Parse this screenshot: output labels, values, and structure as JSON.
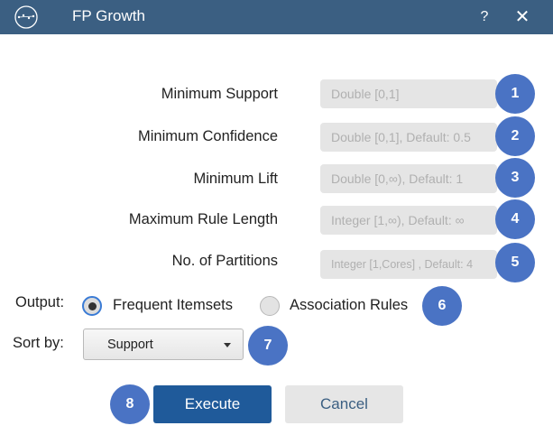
{
  "window": {
    "title": "FP Growth",
    "help_icon": "?",
    "close_icon": "✕",
    "titlebar_color": "#3b5f82"
  },
  "fields": [
    {
      "label": "Minimum Support",
      "placeholder": "Double [0,1]",
      "badge": "1"
    },
    {
      "label": "Minimum Confidence",
      "placeholder": "Double [0,1], Default: 0.5",
      "badge": "2"
    },
    {
      "label": "Minimum Lift",
      "placeholder": "Double [0,∞), Default: 1",
      "badge": "3"
    },
    {
      "label": "Maximum Rule Length",
      "placeholder": "Integer [1,∞), Default: ∞",
      "badge": "4"
    },
    {
      "label": "No. of Partitions",
      "placeholder": "Integer [1,Cores] , Default: 4",
      "badge": "5"
    }
  ],
  "output": {
    "label": "Output:",
    "options": [
      "Frequent Itemsets",
      "Association Rules"
    ],
    "selected": "Frequent Itemsets",
    "badge": "6"
  },
  "sort": {
    "label": "Sort by:",
    "selected": "Support",
    "badge": "7"
  },
  "actions": {
    "execute_label": "Execute",
    "cancel_label": "Cancel",
    "badge": "8",
    "primary_color": "#1f5a9a"
  },
  "badge_color": "#4a73c4"
}
